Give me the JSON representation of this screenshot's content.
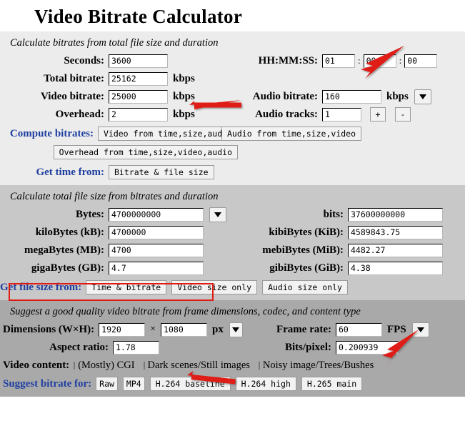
{
  "page": {
    "title": "Video Bitrate Calculator"
  },
  "section1": {
    "caption": "Calculate bitrates from total file size and duration",
    "labels": {
      "seconds": "Seconds:",
      "total_bitrate": "Total bitrate:",
      "video_bitrate": "Video bitrate:",
      "overhead": "Overhead:",
      "compute_bitrates": "Compute bitrates:",
      "get_time_from": "Get time from:",
      "hhmmss": "HH:MM:SS:",
      "audio_bitrate": "Audio bitrate:",
      "audio_tracks": "Audio tracks:"
    },
    "values": {
      "seconds": "3600",
      "total_bitrate": "25162",
      "video_bitrate": "25000",
      "overhead": "2",
      "hours": "01",
      "minutes": "00",
      "seconds_field": "00",
      "audio_bitrate": "160",
      "audio_tracks": "1"
    },
    "units": {
      "kbps": "kbps"
    },
    "separators": {
      "colon": ":"
    },
    "buttons": {
      "video_from": "Video from time,size,audio",
      "audio_from": "Audio from time,size,video",
      "overhead_from": "Overhead from time,size,video,audio",
      "bitrate_filesize": "Bitrate & file size",
      "plus": "+",
      "minus": "-"
    }
  },
  "section2": {
    "caption": "Calculate total file size from bitrates and duration",
    "labels": {
      "bytes": "Bytes:",
      "kilobytes": "kiloBytes (kB):",
      "megabytes": "megaBytes (MB):",
      "gigabytes": "gigaBytes (GB):",
      "bits": "bits:",
      "kibibytes": "kibiBytes (KiB):",
      "mebibytes": "mebiBytes (MiB):",
      "gibibytes": "gibiBytes (GiB):",
      "get_file_size_from": "Get file size from:"
    },
    "values": {
      "bytes": "4700000000",
      "kilobytes": "4700000",
      "megabytes": "4700",
      "gigabytes": "4.7",
      "bits": "37600000000",
      "kibibytes": "4589843.75",
      "mebibytes": "4482.27",
      "gibibytes": "4.38"
    },
    "buttons": {
      "time_bitrate": "Time & bitrate",
      "video_size_only": "Video size only",
      "audio_size_only": "Audio size only"
    }
  },
  "section3": {
    "caption": "Suggest a good quality video bitrate from frame dimensions, codec, and content type",
    "labels": {
      "dimensions": "Dimensions (W×H):",
      "aspect_ratio": "Aspect ratio:",
      "video_content": "Video content:",
      "suggest_bitrate_for": "Suggest bitrate for:",
      "frame_rate": "Frame rate:",
      "bits_pixel": "Bits/pixel:"
    },
    "values": {
      "width": "1920",
      "height": "1080",
      "aspect_ratio": "1.78",
      "frame_rate": "60",
      "bits_pixel": "0.200939"
    },
    "units": {
      "px": "px",
      "fps": "FPS",
      "times": "×"
    },
    "checkboxes": [
      {
        "label": "(Mostly) CGI",
        "checked": false
      },
      {
        "label": "Dark scenes/Still images",
        "checked": false
      },
      {
        "label": "Noisy image/Trees/Bushes",
        "checked": false
      }
    ],
    "buttons": {
      "raw": "Raw",
      "mp4": "MP4",
      "h264_baseline": "H.264 baseline",
      "h264_high": "H.264 high",
      "h265_main": "H.265 main"
    }
  },
  "annotations": {
    "highlight_color": "#e01b12",
    "arrow_color": "#e01b12",
    "arrow_count": 4,
    "highlight_box_target": "gigaBytes (GB) field row"
  },
  "colors": {
    "section1_bg": "#ececec",
    "section2_bg": "#c8c8c8",
    "section3_bg": "#a9a9a9",
    "label_blue": "#1f3fa0",
    "page_bg": "#ffffff"
  }
}
